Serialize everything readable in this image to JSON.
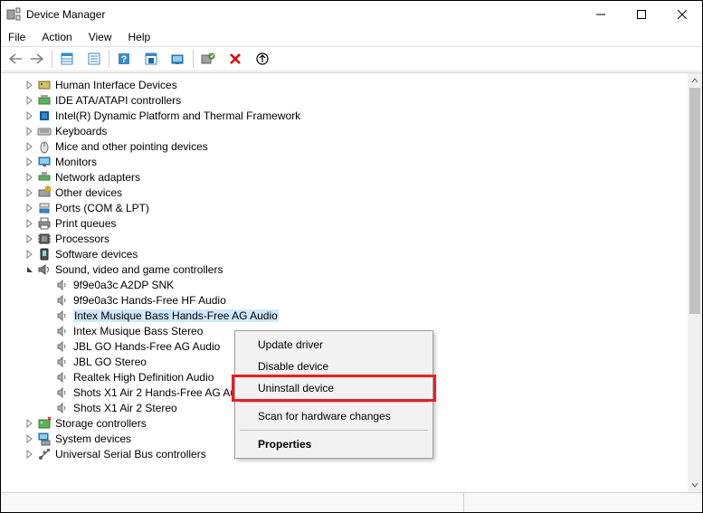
{
  "window": {
    "title": "Device Manager"
  },
  "menubar": {
    "file": "File",
    "action": "Action",
    "view": "View",
    "help": "Help"
  },
  "tree": {
    "categories": [
      {
        "name": "Human Interface Devices",
        "icon": "hid-icon"
      },
      {
        "name": "IDE ATA/ATAPI controllers",
        "icon": "ide-icon"
      },
      {
        "name": "Intel(R) Dynamic Platform and Thermal Framework",
        "icon": "intel-icon"
      },
      {
        "name": "Keyboards",
        "icon": "keyboard-icon"
      },
      {
        "name": "Mice and other pointing devices",
        "icon": "mouse-icon"
      },
      {
        "name": "Monitors",
        "icon": "monitor-icon"
      },
      {
        "name": "Network adapters",
        "icon": "network-icon"
      },
      {
        "name": "Other devices",
        "icon": "other-icon"
      },
      {
        "name": "Ports (COM & LPT)",
        "icon": "ports-icon"
      },
      {
        "name": "Print queues",
        "icon": "printer-icon"
      },
      {
        "name": "Processors",
        "icon": "processor-icon"
      },
      {
        "name": "Software devices",
        "icon": "software-icon"
      },
      {
        "name": "Sound, video and game controllers",
        "icon": "sound-icon"
      }
    ],
    "sound_children": [
      "9f9e0a3c A2DP SNK",
      "9f9e0a3c Hands-Free HF Audio",
      "Intex Musique Bass Hands-Free AG Audio",
      "Intex Musique Bass Stereo",
      "JBL GO Hands-Free AG Audio",
      "JBL GO Stereo",
      "Realtek High Definition Audio",
      "Shots X1 Air 2 Hands-Free AG Audio",
      "Shots X1 Air 2 Stereo"
    ],
    "selected_index": 2,
    "categories_after": [
      {
        "name": "Storage controllers",
        "icon": "storage-icon"
      },
      {
        "name": "System devices",
        "icon": "system-icon"
      },
      {
        "name": "Universal Serial Bus controllers",
        "icon": "usb-icon"
      }
    ]
  },
  "context_menu": {
    "items": [
      {
        "label": "Update driver"
      },
      {
        "label": "Disable device"
      },
      {
        "label": "Uninstall device",
        "highlight": true
      },
      {
        "sep": true
      },
      {
        "label": "Scan for hardware changes"
      },
      {
        "sep": true
      },
      {
        "label": "Properties",
        "bold": true
      }
    ]
  }
}
